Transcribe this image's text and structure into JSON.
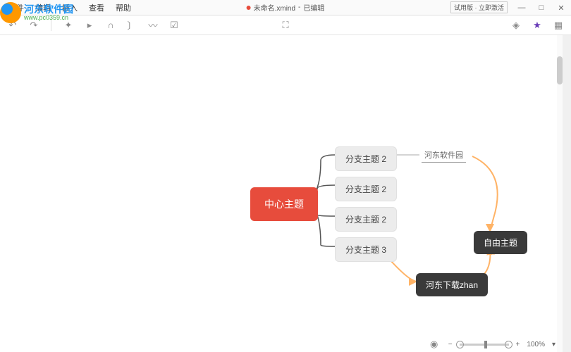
{
  "watermark": {
    "title": "河东软件园",
    "url": "www.pc0359.cn"
  },
  "menu": {
    "file": "文件",
    "edit": "编辑",
    "insert": "插入",
    "view": "查看",
    "help": "帮助"
  },
  "title": {
    "filename": "未命名.xmind",
    "status": "已编辑"
  },
  "trial": {
    "label": "试用版 · 立即激活"
  },
  "window": {
    "min": "—",
    "max": "□",
    "close": "✕"
  },
  "mindmap": {
    "central": "中心主题",
    "branches": [
      "分支主题 2",
      "分支主题 2",
      "分支主题 2",
      "分支主题 3"
    ],
    "label1": "河东软件园",
    "free_topic": "自由主题",
    "callout": "河东下载zhan"
  },
  "status": {
    "zoom": "100%"
  }
}
